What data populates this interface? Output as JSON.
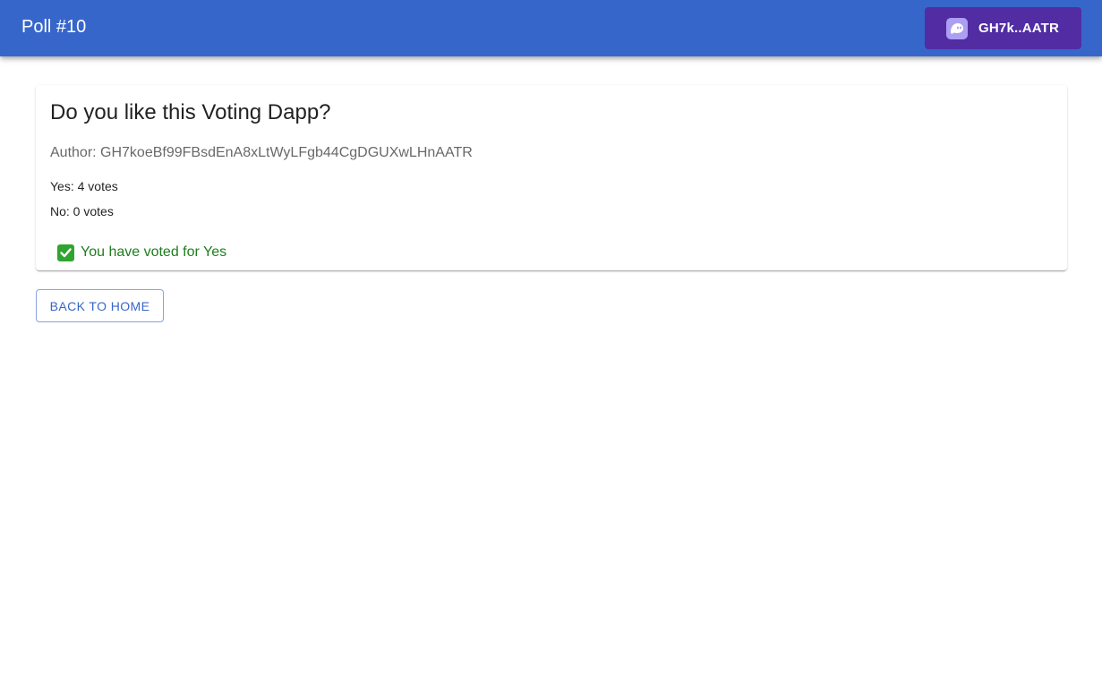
{
  "appbar": {
    "title": "Poll #10",
    "wallet": {
      "label": "GH7k..AATR",
      "icon": "phantom-ghost-icon"
    }
  },
  "poll": {
    "question": "Do you like this Voting Dapp?",
    "author": "Author: GH7koeBf99FBsdEnA8xLtWyLFgb44CgDGUXwLHnAATR",
    "yes_votes": "Yes: 4 votes",
    "no_votes": "No: 0 votes",
    "status": "You have voted for Yes",
    "status_icon": "check-mark-icon"
  },
  "actions": {
    "back_label": "BACK TO HOME"
  },
  "colors": {
    "appbar": "#3766cb",
    "wallet_button": "#512ca3",
    "success_text": "#1e7d1e"
  }
}
